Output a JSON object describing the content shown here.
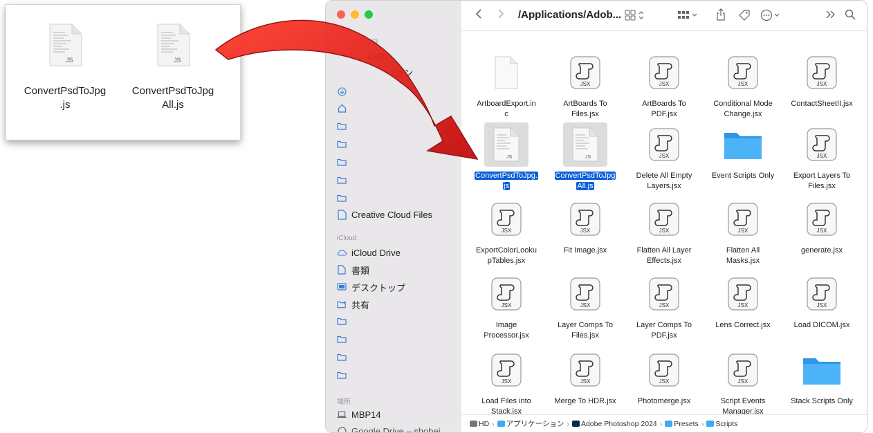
{
  "callout": {
    "files": [
      {
        "name_line1": "ConvertPsdToJpg",
        "name_line2": ".js",
        "badge": "JS"
      },
      {
        "name_line1": "ConvertPsdToJpg",
        "name_line2": "All.js",
        "badge": "JS"
      }
    ]
  },
  "finder": {
    "title": "/Applications/Adob...",
    "colors": {
      "close": "#fe5f57",
      "minimize": "#febc2e",
      "zoom": "#28c840",
      "selection": "#0a5fd7",
      "folder": "#3fa9f5"
    },
    "sidebar": {
      "favorites_header": "よく使う項目",
      "favorite_partial_1": "Drop",
      "favorite_partial_2": "ョン",
      "favorites_icons": [
        "download-icon",
        "home-icon",
        "folder-icon",
        "folder-icon",
        "folder-icon",
        "folder-icon",
        "folder-icon"
      ],
      "creative_cloud": "Creative Cloud Files",
      "icloud_header": "iCloud",
      "icloud_items": [
        {
          "label": "iCloud Drive",
          "icon": "cloud-icon"
        },
        {
          "label": "書類",
          "icon": "document-icon"
        },
        {
          "label": "デスクトップ",
          "icon": "desktop-icon"
        },
        {
          "label": "共有",
          "icon": "shared-folder-icon"
        }
      ],
      "locations_header": "場所",
      "locations": [
        {
          "label": "MBP14",
          "icon": "laptop-icon"
        },
        {
          "label": "Google Drive – shohei",
          "icon": "drive-icon"
        }
      ]
    },
    "files": [
      {
        "line1": "ArtboardExport.in",
        "line2": "c",
        "kind": "blank"
      },
      {
        "line1": "ArtBoards To",
        "line2": "Files.jsx",
        "kind": "jsx"
      },
      {
        "line1": "ArtBoards To",
        "line2": "PDF.jsx",
        "kind": "jsx"
      },
      {
        "line1": "Conditional Mode",
        "line2": "Change.jsx",
        "kind": "jsx"
      },
      {
        "line1": "ContactSheetII.jsx",
        "line2": "",
        "kind": "jsx"
      },
      {
        "line1": "ConvertPsdToJpg.",
        "line2": "js",
        "kind": "js",
        "selected": true
      },
      {
        "line1": "ConvertPsdToJpg",
        "line2": "All.js",
        "kind": "js",
        "selected": true
      },
      {
        "line1": "Delete All Empty",
        "line2": "Layers.jsx",
        "kind": "jsx"
      },
      {
        "line1": "Event Scripts Only",
        "line2": "",
        "kind": "folder"
      },
      {
        "line1": "Export Layers To",
        "line2": "Files.jsx",
        "kind": "jsx"
      },
      {
        "line1": "ExportColorLooku",
        "line2": "pTables.jsx",
        "kind": "jsx"
      },
      {
        "line1": "Fit Image.jsx",
        "line2": "",
        "kind": "jsx"
      },
      {
        "line1": "Flatten All Layer",
        "line2": "Effects.jsx",
        "kind": "jsx"
      },
      {
        "line1": "Flatten All",
        "line2": "Masks.jsx",
        "kind": "jsx"
      },
      {
        "line1": "generate.jsx",
        "line2": "",
        "kind": "jsx"
      },
      {
        "line1": "Image",
        "line2": "Processor.jsx",
        "kind": "jsx"
      },
      {
        "line1": "Layer Comps To",
        "line2": "Files.jsx",
        "kind": "jsx"
      },
      {
        "line1": "Layer Comps To",
        "line2": "PDF.jsx",
        "kind": "jsx"
      },
      {
        "line1": "Lens Correct.jsx",
        "line2": "",
        "kind": "jsx"
      },
      {
        "line1": "Load DICOM.jsx",
        "line2": "",
        "kind": "jsx"
      },
      {
        "line1": "Load Files into",
        "line2": "Stack.jsx",
        "kind": "jsx"
      },
      {
        "line1": "Merge To HDR.jsx",
        "line2": "",
        "kind": "jsx"
      },
      {
        "line1": "Photomerge.jsx",
        "line2": "",
        "kind": "jsx"
      },
      {
        "line1": "Script Events",
        "line2": "Manager.jsx",
        "kind": "jsx"
      },
      {
        "line1": "Stack Scripts Only",
        "line2": "",
        "kind": "folder"
      }
    ],
    "jsx_badge": "JSX",
    "js_badge": "JS",
    "pathbar": [
      "HD",
      "アプリケーション",
      "Adobe Photoshop 2024",
      "Presets",
      "Scripts"
    ]
  }
}
